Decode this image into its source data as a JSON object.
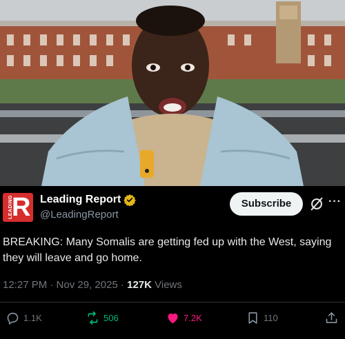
{
  "tweet": {
    "logo_letter": "R",
    "logo_text": "LEADING",
    "author_name": "Leading Report",
    "author_handle": "@LeadingReport",
    "subscribe_label": "Subscribe",
    "more_label": "···",
    "text": "BREAKING: Many Somalis are getting fed up with the West, saying they will leave and go home.",
    "time": "12:27 PM · Nov 29, 2025 · ",
    "views_count": "127K",
    "views_label": " Views",
    "stats": {
      "replies": "1.1K",
      "reposts": "506",
      "likes": "7.2K",
      "bookmarks": "110"
    }
  },
  "icons": [
    "verified-badge-icon",
    "grok-icon",
    "more-icon",
    "reply-icon",
    "repost-icon",
    "like-icon",
    "bookmark-icon",
    "share-icon"
  ],
  "colors": {
    "background": "#000000",
    "text": "#e7e9ea",
    "muted": "#71767b",
    "repost": "#00ba7c",
    "like": "#f91880",
    "verified": "#e2b719",
    "logo": "#d62d2d"
  }
}
